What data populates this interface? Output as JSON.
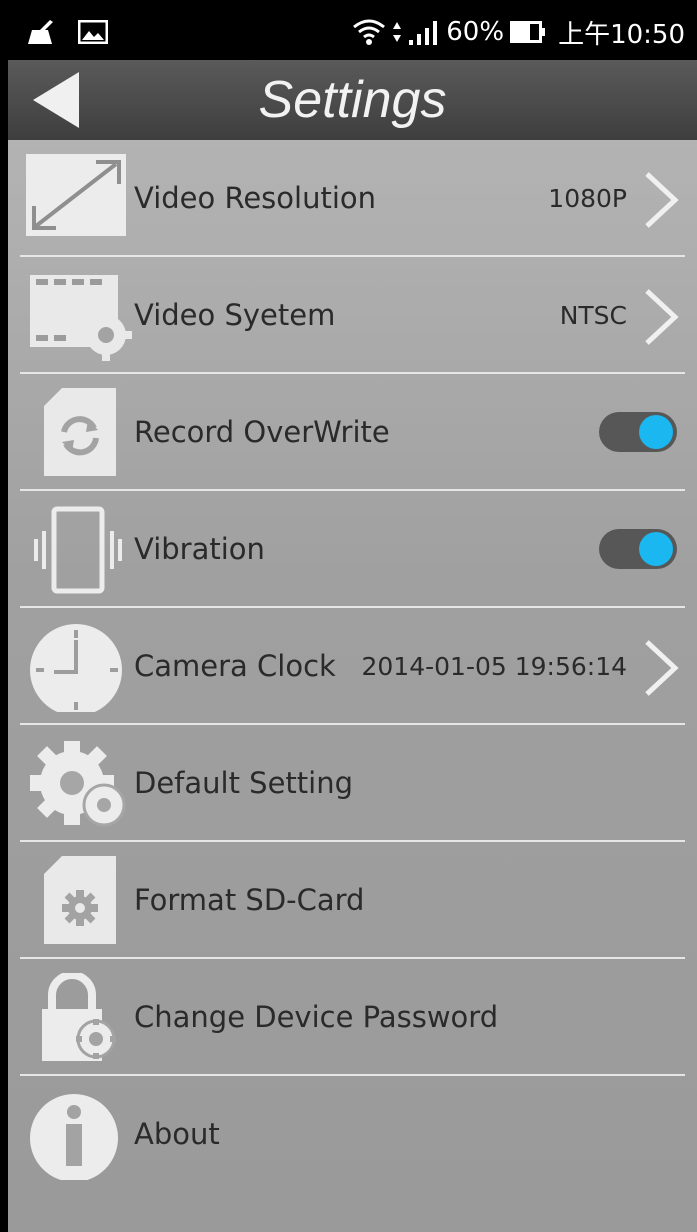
{
  "status_bar": {
    "battery": "60%",
    "time": "上午10:50"
  },
  "header": {
    "title": "Settings"
  },
  "settings": [
    {
      "label": "Video Resolution",
      "value": "1080P",
      "icon": "resize-arrows-icon",
      "control": "chevron"
    },
    {
      "label": "Video Syetem",
      "value": "NTSC",
      "icon": "film-gear-icon",
      "control": "chevron"
    },
    {
      "label": "Record OverWrite",
      "value": "",
      "icon": "sd-card-refresh-icon",
      "control": "toggle",
      "toggle_on": true
    },
    {
      "label": "Vibration",
      "value": "",
      "icon": "phone-vibrate-icon",
      "control": "toggle",
      "toggle_on": true
    },
    {
      "label": "Camera Clock",
      "value": "2014-01-05 19:56:14",
      "icon": "clock-icon",
      "control": "chevron"
    },
    {
      "label": "Default Setting",
      "value": "",
      "icon": "gears-icon",
      "control": "none"
    },
    {
      "label": "Format SD-Card",
      "value": "",
      "icon": "sd-card-gear-icon",
      "control": "none"
    },
    {
      "label": "Change Device Password",
      "value": "",
      "icon": "lock-gear-icon",
      "control": "none"
    },
    {
      "label": "About",
      "value": "",
      "icon": "info-icon",
      "control": "none"
    }
  ],
  "colors": {
    "toggle_on": "#1ab7f0",
    "toggle_track": "#575757"
  }
}
